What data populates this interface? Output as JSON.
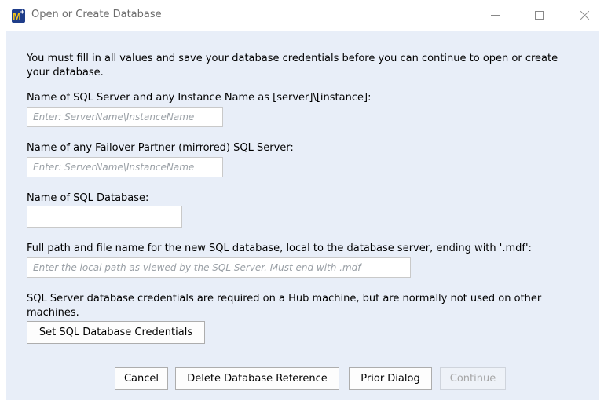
{
  "window": {
    "title": "Open or Create Database",
    "app_icon": "m-plus-app-icon"
  },
  "intro": {
    "line1": "You must fill in all values and save your database credentials before you can continue to open or create",
    "line2": "your database."
  },
  "server": {
    "label": "Name of SQL Server and any Instance Name as [server]\\[instance]:",
    "placeholder": "Enter: ServerName\\InstanceName",
    "value": ""
  },
  "failover": {
    "label": "Name of any Failover Partner (mirrored) SQL Server:",
    "placeholder": "Enter: ServerName\\InstanceName",
    "value": ""
  },
  "database": {
    "label": "Name of SQL Database:",
    "value": ""
  },
  "path": {
    "label": "Full path and file name for the new SQL database, local to the database server, ending with '.mdf':",
    "placeholder": "Enter the local path as viewed by the SQL Server. Must end with .mdf",
    "value": ""
  },
  "credentials": {
    "note_line1": "SQL Server database credentials are required on a Hub machine, but are normally not used on other",
    "note_line2": "machines.",
    "button_label": "Set SQL Database Credentials"
  },
  "footer": {
    "cancel_label": "Cancel",
    "delete_label": "Delete Database Reference",
    "prior_label": "Prior Dialog",
    "continue_label": "Continue",
    "continue_enabled": false
  }
}
